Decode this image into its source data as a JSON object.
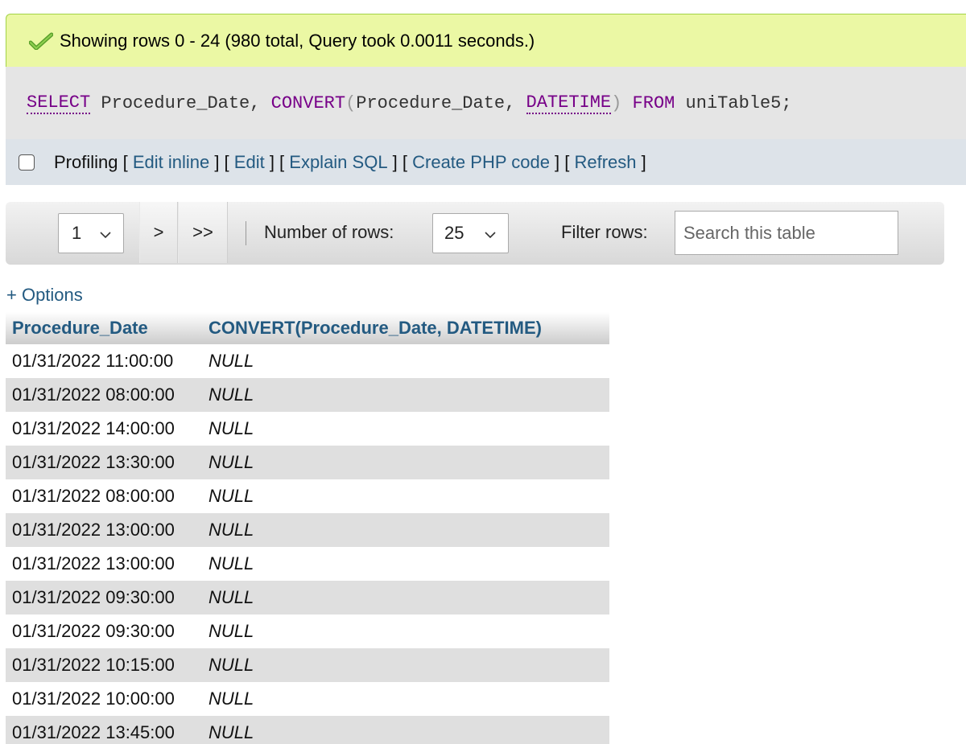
{
  "status": {
    "message": "Showing rows 0 - 24 (980 total, Query took 0.0011 seconds.)",
    "icon": "check-icon",
    "color": "#ebf8a4"
  },
  "sql": {
    "t1": "SELECT",
    "t2": " Procedure_Date, ",
    "t3": "CONVERT",
    "t4": "(",
    "t5": "Procedure_Date, ",
    "t6": "DATETIME",
    "t7": ")",
    "t8": " FROM",
    "t9": " uniTable5;"
  },
  "profiling": {
    "label": "Profiling",
    "links": [
      "Edit inline",
      "Edit",
      "Explain SQL",
      "Create PHP code",
      "Refresh"
    ]
  },
  "nav": {
    "page_value": "1",
    "next": ">",
    "last": ">>",
    "rows_label": "Number of rows:",
    "rows_value": "25",
    "filter_label": "Filter rows:",
    "search_placeholder": "Search this table"
  },
  "options_link": "+ Options",
  "table": {
    "headers": [
      "Procedure_Date",
      "CONVERT(Procedure_Date, DATETIME)"
    ],
    "rows": [
      [
        "01/31/2022 11:00:00",
        "NULL"
      ],
      [
        "01/31/2022 08:00:00",
        "NULL"
      ],
      [
        "01/31/2022 14:00:00",
        "NULL"
      ],
      [
        "01/31/2022 13:30:00",
        "NULL"
      ],
      [
        "01/31/2022 08:00:00",
        "NULL"
      ],
      [
        "01/31/2022 13:00:00",
        "NULL"
      ],
      [
        "01/31/2022 13:00:00",
        "NULL"
      ],
      [
        "01/31/2022 09:30:00",
        "NULL"
      ],
      [
        "01/31/2022 09:30:00",
        "NULL"
      ],
      [
        "01/31/2022 10:15:00",
        "NULL"
      ],
      [
        "01/31/2022 10:00:00",
        "NULL"
      ],
      [
        "01/31/2022 13:45:00",
        "NULL"
      ]
    ]
  },
  "colors": {
    "link": "#235a81",
    "sql_keyword": "#770088"
  }
}
